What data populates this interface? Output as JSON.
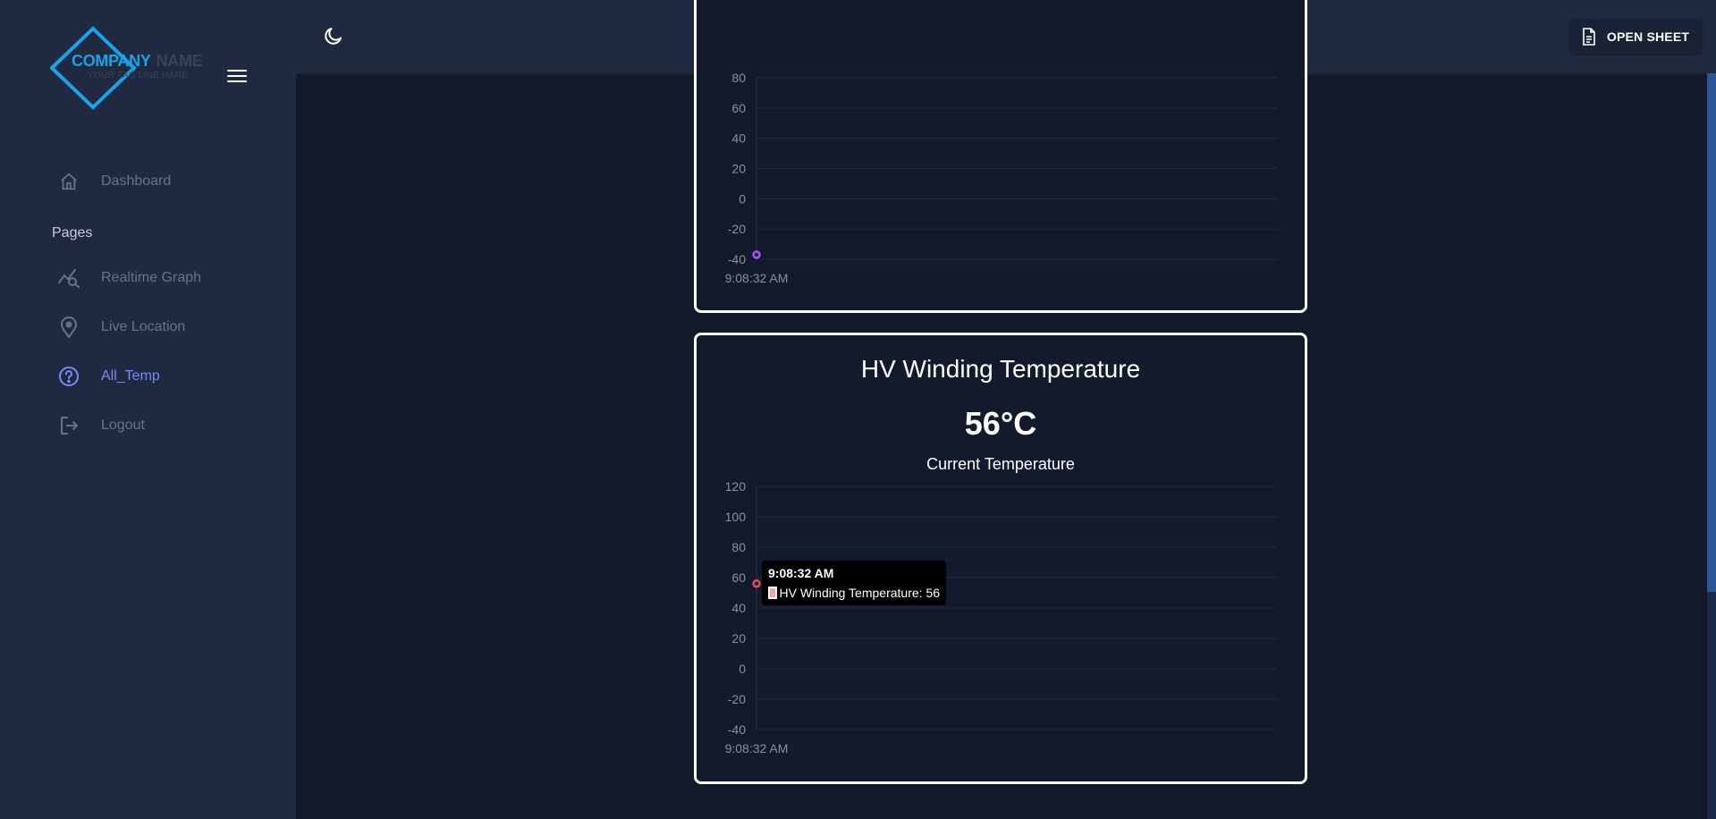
{
  "brand": {
    "company": "COMPANY",
    "name": "NAME",
    "tagline": "YOUR TAG LINE HARE",
    "color": "#1aa3e8"
  },
  "sidebar": {
    "items": [
      {
        "label": "Dashboard",
        "icon": "home-icon"
      },
      {
        "label": "Realtime Graph",
        "icon": "chart-search-icon"
      },
      {
        "label": "Live Location",
        "icon": "location-pin-icon"
      },
      {
        "label": "All_Temp",
        "icon": "help-circle-icon",
        "active": true
      },
      {
        "label": "Logout",
        "icon": "logout-icon"
      }
    ],
    "section_label": "Pages"
  },
  "topbar": {
    "theme_toggle_icon": "moon-icon",
    "open_sheet_label": "OPEN SHEET",
    "open_sheet_icon": "document-icon"
  },
  "colors": {
    "accent": "#7b8af5",
    "series_purple": "#a855f7",
    "series_red": "#e04e5e"
  },
  "chart_data": [
    {
      "type": "line",
      "title": "",
      "yticks": [
        -40,
        -20,
        0,
        20,
        40,
        60,
        80
      ],
      "x": [
        "9:08:32 AM"
      ],
      "series": [
        {
          "values": [
            -37
          ]
        }
      ],
      "grid": true
    },
    {
      "type": "line",
      "title": "HV Winding Temperature",
      "current_value": "56°C",
      "current_label": "Current Temperature",
      "yticks": [
        -40,
        -20,
        0,
        20,
        40,
        60,
        80,
        100,
        120
      ],
      "ylim": [
        -40,
        120
      ],
      "x": [
        "9:08:32 AM"
      ],
      "series": [
        {
          "name": "HV Winding Temperature",
          "values": [
            56
          ]
        }
      ],
      "grid": true,
      "tooltip": {
        "title": "9:08:32 AM",
        "text": "HV Winding Temperature: 56"
      }
    }
  ]
}
